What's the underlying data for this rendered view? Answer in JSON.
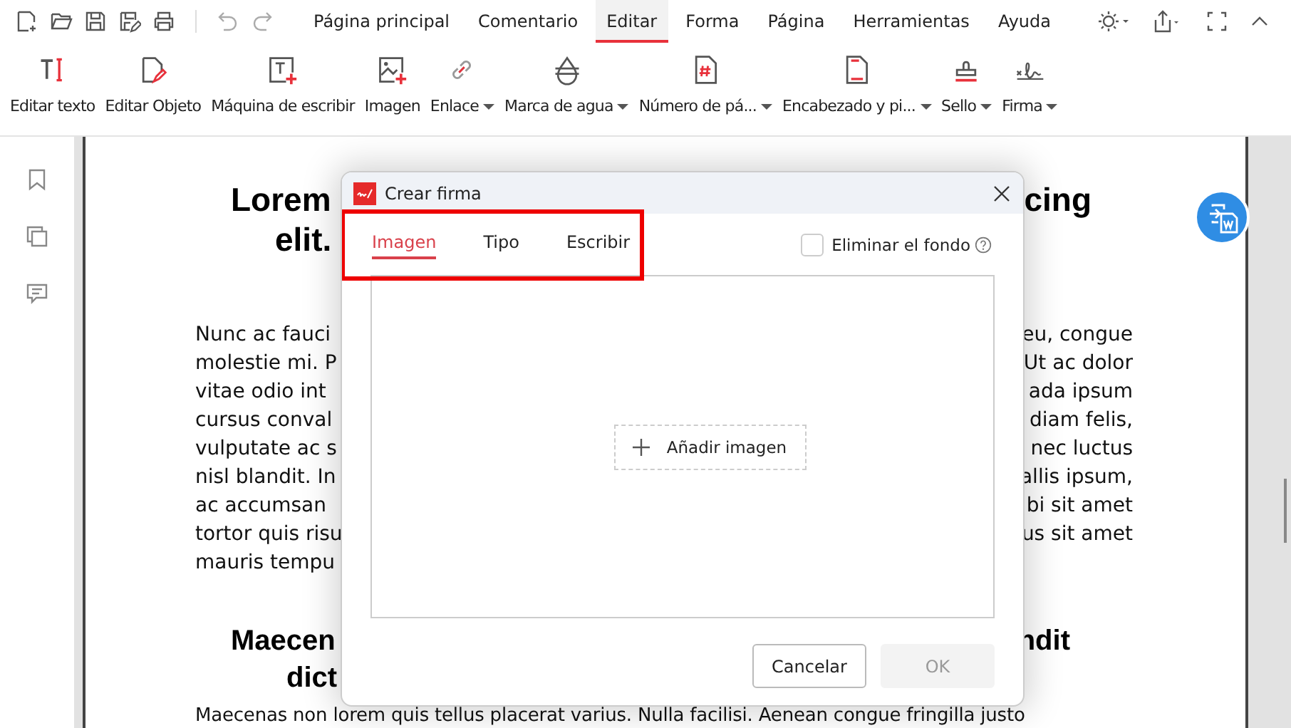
{
  "menu_tabs": [
    {
      "label": "Página principal",
      "selected": false
    },
    {
      "label": "Comentario",
      "selected": false
    },
    {
      "label": "Editar",
      "selected": true
    },
    {
      "label": "Forma",
      "selected": false
    },
    {
      "label": "Página",
      "selected": false
    },
    {
      "label": "Herramientas",
      "selected": false
    },
    {
      "label": "Ayuda",
      "selected": false
    }
  ],
  "tools": [
    {
      "kind": "text",
      "label": "Editar texto",
      "has_menu": false
    },
    {
      "kind": "object",
      "label": "Editar Objeto",
      "has_menu": false
    },
    {
      "kind": "typewriter",
      "label": "Máquina de escribir",
      "has_menu": false
    },
    {
      "kind": "image",
      "label": "Imagen",
      "has_menu": false
    },
    {
      "kind": "link",
      "label": "Enlace",
      "has_menu": true
    },
    {
      "kind": "watermark",
      "label": "Marca de agua",
      "has_menu": true
    },
    {
      "kind": "pagenum",
      "label": "Número de pá...",
      "has_menu": true
    },
    {
      "kind": "header",
      "label": "Encabezado y pi...",
      "has_menu": true
    },
    {
      "kind": "stamp",
      "label": "Sello",
      "has_menu": true
    },
    {
      "kind": "signature",
      "label": "Firma",
      "has_menu": true
    }
  ],
  "document": {
    "heading_1": [
      {
        "left": "Lorem",
        "right": "cing"
      },
      {
        "left": "elit."
      }
    ],
    "paragraph_1": [
      {
        "left": "Nunc ac fauci",
        "right": "eu, congue"
      },
      {
        "left": "molestie mi. P",
        "right": "Ut ac dolor"
      },
      {
        "left": "vitae odio int",
        "right": "ada ipsum"
      },
      {
        "left": "cursus conval",
        "right": "diam felis,"
      },
      {
        "left": "vulputate ac s",
        "right": "nec luctus"
      },
      {
        "left": "nisl blandit. In",
        "right": "allis ipsum,"
      },
      {
        "left": "ac accumsan",
        "right": "bi sit amet"
      },
      {
        "left": "tortor quis risu",
        "right": "us sit amet"
      },
      {
        "left": "mauris tempu"
      }
    ],
    "heading_2": [
      {
        "left": "Maecen",
        "right": "ndit"
      },
      {
        "left": "dict"
      }
    ],
    "paragraph_2": "Maecenas non lorem quis tellus placerat varius. Nulla facilisi. Aenean congue fringilla justo"
  },
  "dialog": {
    "title": "Crear firma",
    "tabs": [
      {
        "label": "Imagen",
        "selected": true
      },
      {
        "label": "Tipo",
        "selected": false
      },
      {
        "label": "Escribir",
        "selected": false
      }
    ],
    "remove_background": {
      "label": "Eliminar el fondo",
      "checked": false
    },
    "add_image": "Añadir imagen",
    "buttons": [
      {
        "label": "Cancelar",
        "disabled": false
      },
      {
        "label": "OK",
        "disabled": true
      }
    ]
  }
}
